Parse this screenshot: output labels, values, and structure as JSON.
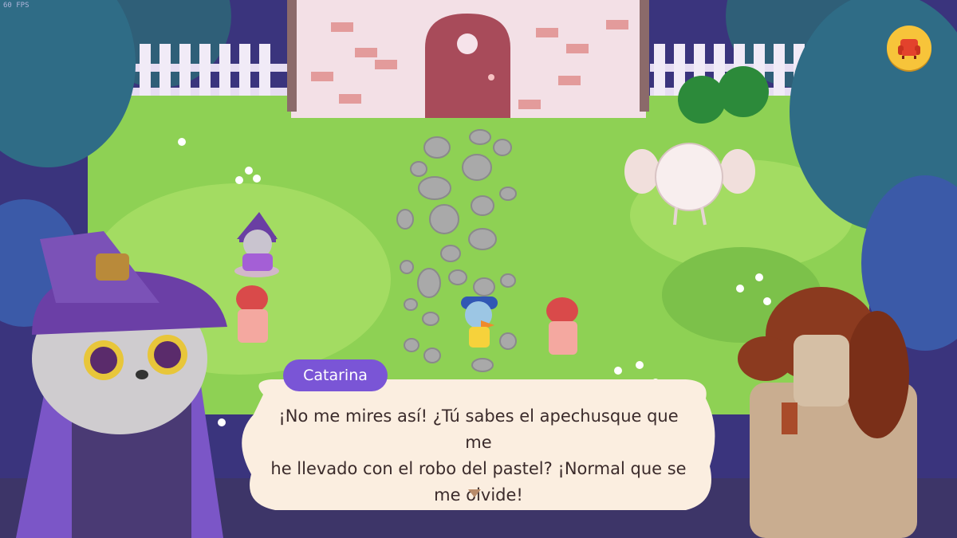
{
  "hud": {
    "fps_label": "60 FPS",
    "menu_icon": "armchair-icon"
  },
  "dialog": {
    "speaker": "Catarina",
    "line1": "¡No me mires así! ¿Tú sabes el apechusque que me",
    "line2": "he llevado con el robo del pastel? ¡Normal que se",
    "line3": "me olvide!",
    "next_icon": "triangle-down-icon"
  },
  "colors": {
    "grass": "#8ed154",
    "path_stone": "#a9a9a9",
    "name_tag": "#7a55d6",
    "dialog_bg": "#fbeee0",
    "menu_button": "#f7c43a",
    "sky_purple": "#3b3380"
  }
}
